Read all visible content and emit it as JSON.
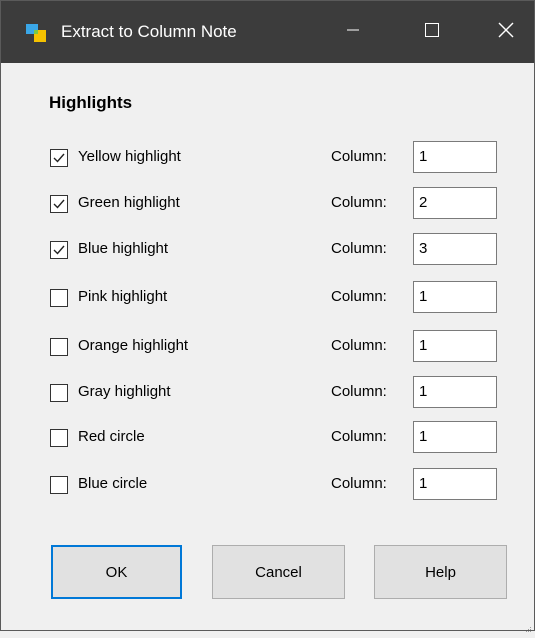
{
  "window": {
    "title": "Extract to Column Note"
  },
  "section": {
    "title": "Highlights"
  },
  "rows": [
    {
      "label": "Yellow highlight",
      "checked": true,
      "column_label": "Column:",
      "column_value": "1"
    },
    {
      "label": "Green highlight",
      "checked": true,
      "column_label": "Column:",
      "column_value": "2"
    },
    {
      "label": "Blue highlight",
      "checked": true,
      "column_label": "Column:",
      "column_value": "3"
    },
    {
      "label": "Pink highlight",
      "checked": false,
      "column_label": "Column:",
      "column_value": "1"
    },
    {
      "label": "Orange highlight",
      "checked": false,
      "column_label": "Column:",
      "column_value": "1"
    },
    {
      "label": "Gray highlight",
      "checked": false,
      "column_label": "Column:",
      "column_value": "1"
    },
    {
      "label": "Red circle",
      "checked": false,
      "column_label": "Column:",
      "column_value": "1"
    },
    {
      "label": "Blue circle",
      "checked": false,
      "column_label": "Column:",
      "column_value": "1"
    }
  ],
  "buttons": {
    "ok": "OK",
    "cancel": "Cancel",
    "help": "Help"
  },
  "colors": {
    "titlebar": "#3c3c3c",
    "accent": "#0078d7",
    "background": "#f0f0f0"
  },
  "icons": {
    "app": "app-logo-icon",
    "minimize": "minimize-icon",
    "maximize": "maximize-icon",
    "close": "close-icon",
    "check": "checkmark-icon"
  }
}
